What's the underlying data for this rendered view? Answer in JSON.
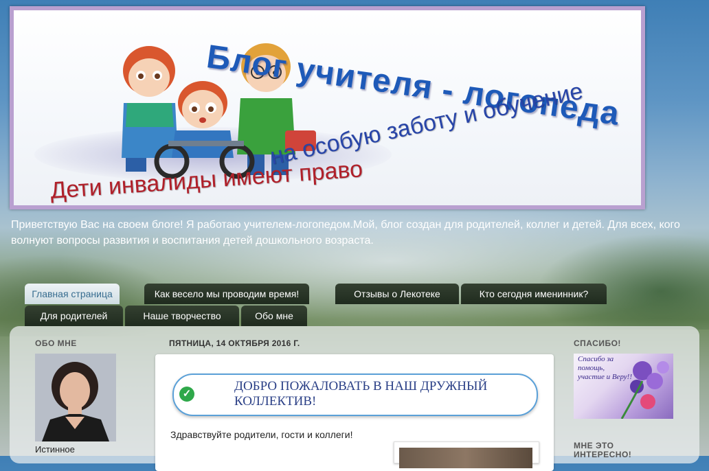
{
  "header": {
    "title": "Блог учителя - логопеда",
    "subtitle_line1": "на особую заботу и обучение",
    "subtitle_line2": "Дети инвалиды имеют право",
    "description": "Приветствую Вас на своем блоге! Я работаю учителем-логопедом.Мой, блог создан для родителей, коллег и детей. Для всех, кого волнуют вопросы развития и воспитания детей дошкольного возраста."
  },
  "tabs": [
    {
      "label": "Главная страница",
      "active": true
    },
    {
      "label": "Как весело мы проводим время!"
    },
    {
      "label": "Отзывы о Лекотеке"
    },
    {
      "label": "Кто сегодня именинник?"
    },
    {
      "label": "Для родителей"
    },
    {
      "label": "Наше творчество"
    },
    {
      "label": "Обо мне"
    }
  ],
  "sidebar_left": {
    "title": "ОБО МНЕ",
    "name": "Истинное"
  },
  "post": {
    "date": "ПЯТНИЦА, 14 ОКТЯБРЯ 2016 Г.",
    "welcome": "ДОБРО ПОЖАЛОВАТЬ В НАШ ДРУЖНЫЙ КОЛЛЕКТИВ!",
    "greeting": "Здравствуйте родители, гости и коллеги!"
  },
  "sidebar_right": {
    "title": "СПАСИБО!",
    "image_text": "Спасибо за помощь, участие и Веру!!",
    "next_title": "МНЕ ЭТО ИНТЕРЕСНО!"
  },
  "colors": {
    "tab_bg": "#27331f",
    "tab_active_text": "#376d90",
    "accent_blue": "#1e5ab8",
    "accent_red": "#b0202a"
  },
  "icons": {
    "check": "check-circle-icon"
  }
}
